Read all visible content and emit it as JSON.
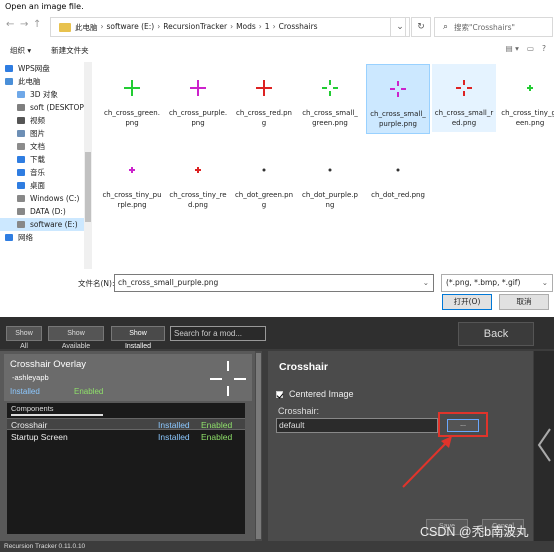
{
  "dialog": {
    "title": "Open an image file.",
    "breadcrumb": [
      "此电脑",
      "software (E:)",
      "RecursionTracker",
      "Mods",
      "1",
      "Crosshairs"
    ],
    "search_placeholder": "搜索\"Crosshairs\"",
    "toolbar": {
      "organize": "组织 ▾",
      "new_folder": "新建文件夹"
    },
    "nav": [
      {
        "label": "WPS网盘",
        "sub": false,
        "color": "#2f7de1"
      },
      {
        "label": "此电脑",
        "sub": false,
        "color": "#4a8fd8"
      },
      {
        "label": "3D 对象",
        "sub": true,
        "color": "#6fa8e8"
      },
      {
        "label": "soft (DESKTOP",
        "sub": true,
        "color": "#7f7f7f"
      },
      {
        "label": "视频",
        "sub": true,
        "color": "#555"
      },
      {
        "label": "图片",
        "sub": true,
        "color": "#6d8fb5"
      },
      {
        "label": "文档",
        "sub": true,
        "color": "#8c8c8c"
      },
      {
        "label": "下载",
        "sub": true,
        "color": "#2f7de1"
      },
      {
        "label": "音乐",
        "sub": true,
        "color": "#2f7de1"
      },
      {
        "label": "桌面",
        "sub": true,
        "color": "#2f7de1"
      },
      {
        "label": "Windows (C:)",
        "sub": true,
        "color": "#888"
      },
      {
        "label": "DATA (D:)",
        "sub": true,
        "color": "#888"
      },
      {
        "label": "software (E:)",
        "sub": true,
        "color": "#888",
        "selected": true
      },
      {
        "label": "网络",
        "sub": false,
        "color": "#2f7de1"
      }
    ],
    "files": [
      {
        "name": "ch_cross_green.png",
        "kind": "cross",
        "color": "#22cc33",
        "state": ""
      },
      {
        "name": "ch_cross_purple.png",
        "kind": "cross",
        "color": "#cc22cc",
        "state": ""
      },
      {
        "name": "ch_cross_red.png",
        "kind": "cross",
        "color": "#dd2222",
        "state": ""
      },
      {
        "name": "ch_cross_small_green.png",
        "kind": "small",
        "color": "#22cc33",
        "state": ""
      },
      {
        "name": "ch_cross_small_purple.png",
        "kind": "small",
        "color": "#cc22cc",
        "state": "selected"
      },
      {
        "name": "ch_cross_small_red.png",
        "kind": "small",
        "color": "#dd2222",
        "state": "hover"
      },
      {
        "name": "ch_cross_tiny_green.png",
        "kind": "tiny",
        "color": "#22cc33",
        "state": ""
      },
      {
        "name": "ch_cross_tiny_purple.png",
        "kind": "tiny",
        "color": "#cc22cc",
        "state": ""
      },
      {
        "name": "ch_cross_tiny_red.png",
        "kind": "tiny",
        "color": "#dd2222",
        "state": ""
      },
      {
        "name": "ch_dot_green.png",
        "kind": "dot",
        "color": "#333333",
        "state": ""
      },
      {
        "name": "ch_dot_purple.png",
        "kind": "dot",
        "color": "#333333",
        "state": ""
      },
      {
        "name": "ch_dot_red.png",
        "kind": "dot",
        "color": "#333333",
        "state": ""
      }
    ],
    "filename_label": "文件名(N):",
    "filename_value": "ch_cross_small_purple.png",
    "filter_value": "(*.png, *.bmp, *.gif)",
    "open_label": "打开(O)",
    "cancel_label": "取消"
  },
  "app": {
    "top_buttons": [
      "Show All",
      "Show Available",
      "Show Installed"
    ],
    "search_placeholder": "Search for a mod...",
    "back_label": "Back",
    "mod": {
      "name": "Crosshair Overlay",
      "author": "-ashleyapb",
      "installed": "Installed",
      "enabled": "Enabled"
    },
    "components_header": "Components",
    "components": [
      {
        "name": "Crosshair",
        "installed": "Installed",
        "enabled": "Enabled",
        "selected": true
      },
      {
        "name": "Startup Screen",
        "installed": "Installed",
        "enabled": "Enabled",
        "selected": false
      }
    ],
    "detail": {
      "title": "Crosshair",
      "centered_label": "Centered Image",
      "centered_checked": true,
      "crosshair_label": "Crosshair:",
      "crosshair_value": "default",
      "browse_label": "...",
      "save_label": "Save",
      "cancel_label": "Cancel"
    },
    "version": "Recursion Tracker 0.11.0.10",
    "watermark": "CSDN @秃b南波丸",
    "accent_colors": {
      "installed": "#8cc8ff",
      "enabled": "#8fe06a",
      "highlight": "#e0342b"
    }
  }
}
